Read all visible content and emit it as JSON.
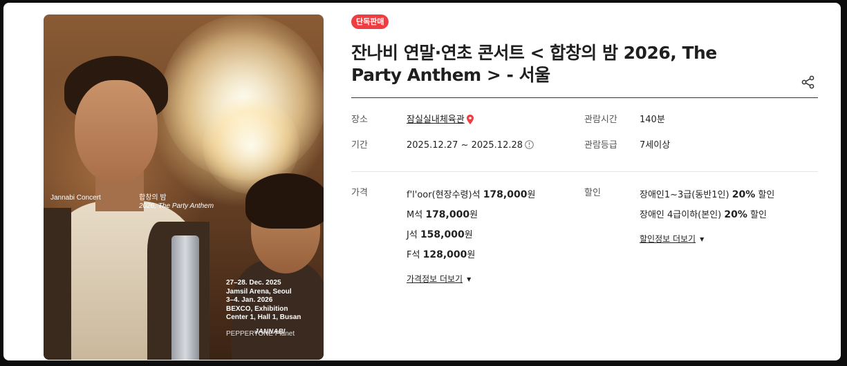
{
  "poster": {
    "concert_name": "Jannabi Concert",
    "kor_title": "합창의 밤",
    "sub_title": "2026, The Party Anthem",
    "dates": [
      "27–28. Dec. 2025",
      "Jamsil Arena, Seoul",
      "3–4. Jan. 2026",
      "BEXCO, Exhibition",
      "Center 1, Hall 1, Busan"
    ],
    "logo1": "PEPPERTONE Planet",
    "logo2": "JANNABI"
  },
  "badge": "단독판매",
  "title": "잔나비 연말·연초 콘서트 < 합창의 밤 2026, The Party Anthem > - 서울",
  "info": {
    "venue_label": "장소",
    "venue": "잠실실내체육관",
    "period_label": "기간",
    "period": "2025.12.27 ~ 2025.12.28",
    "duration_label": "관람시간",
    "duration": "140분",
    "age_label": "관람등급",
    "age": "7세이상"
  },
  "price": {
    "label": "가격",
    "items": [
      {
        "seat": "f'l'oor(현장수령)석",
        "price": "178,000",
        "unit": "원"
      },
      {
        "seat": "M석",
        "price": "178,000",
        "unit": "원"
      },
      {
        "seat": "J석",
        "price": "158,000",
        "unit": "원"
      },
      {
        "seat": "F석",
        "price": "128,000",
        "unit": "원"
      }
    ],
    "more": "가격정보 더보기"
  },
  "discount": {
    "label": "할인",
    "items": [
      {
        "name": "장애인1~3급(동반1인)",
        "rate": "20%",
        "suffix": "할인"
      },
      {
        "name": "장애인 4급이하(본인)",
        "rate": "20%",
        "suffix": "할인"
      }
    ],
    "more": "할인정보 더보기"
  },
  "colors": {
    "accent": "#ef3e42",
    "text": "#222222",
    "rule": "#333333"
  }
}
